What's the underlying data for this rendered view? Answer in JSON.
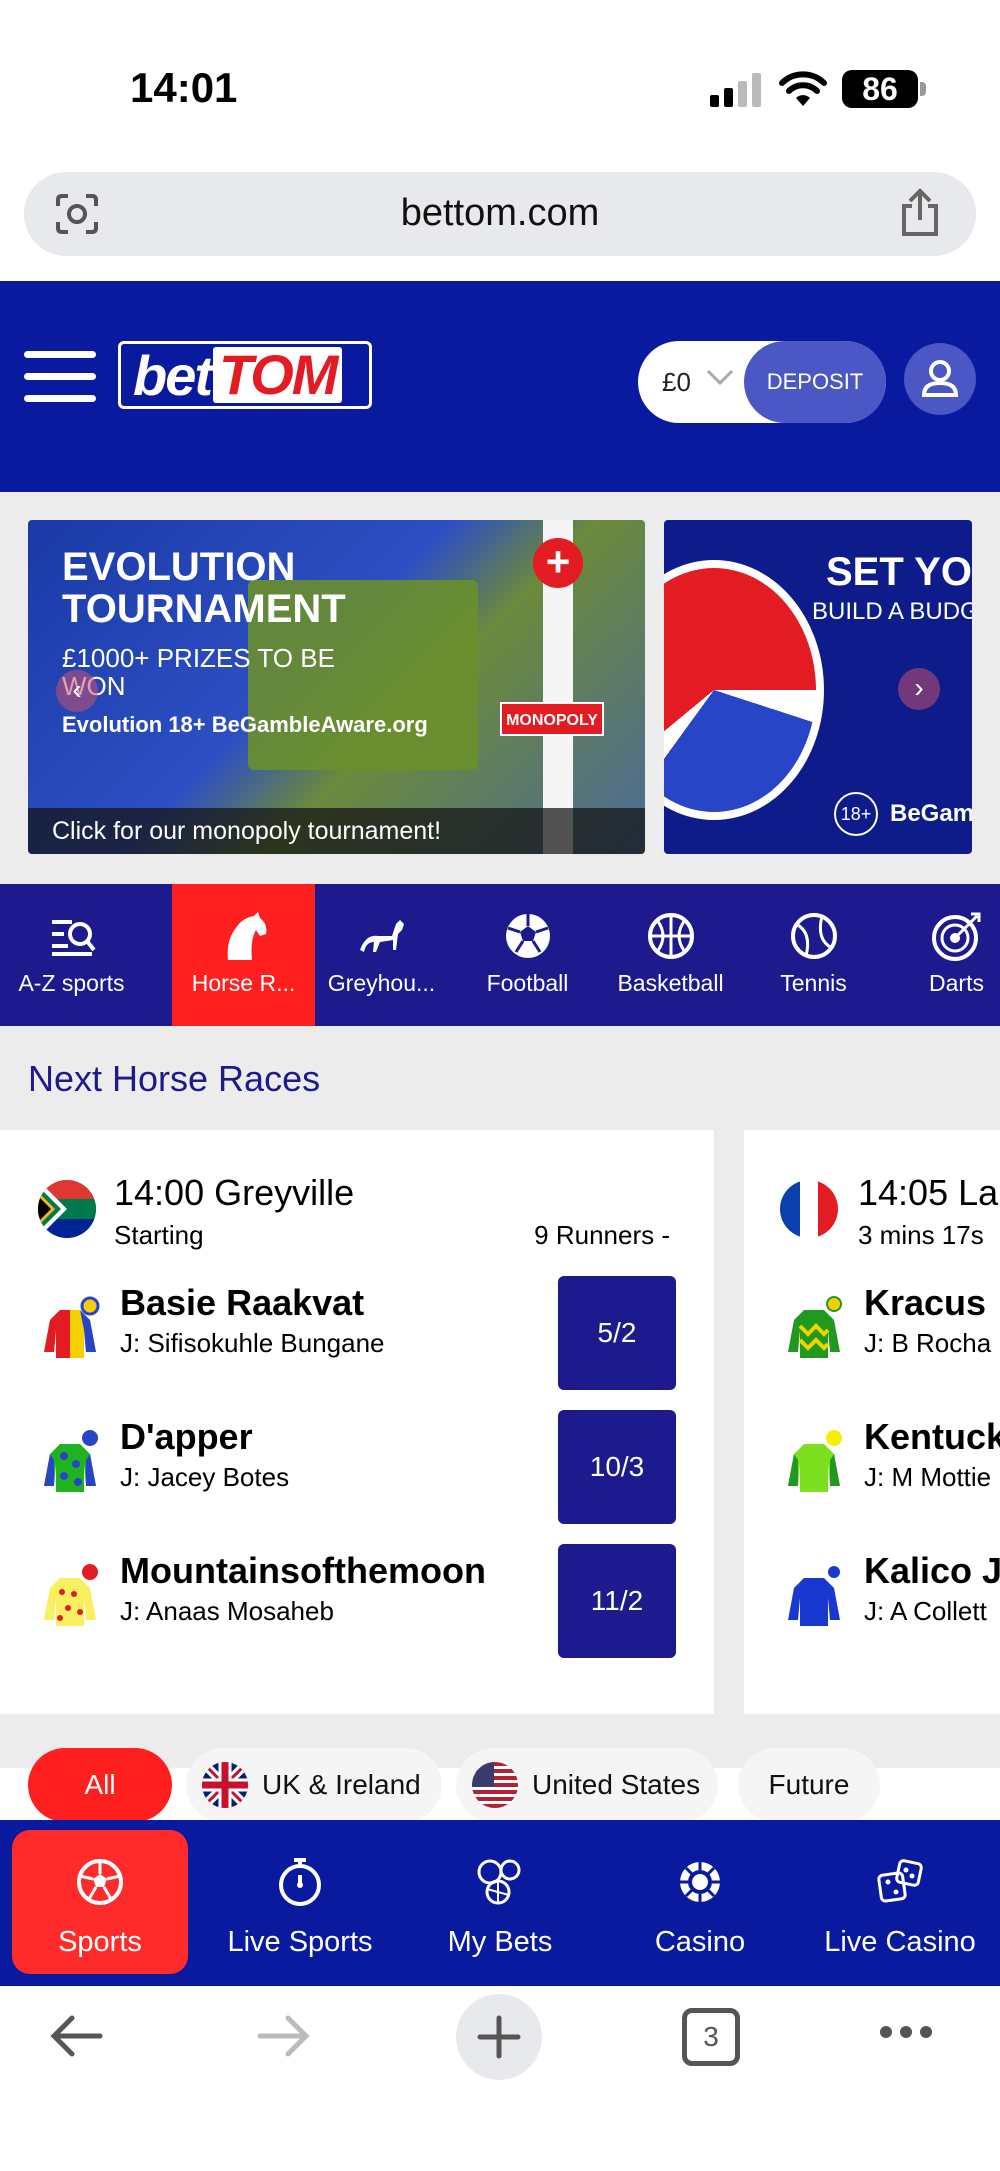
{
  "status_bar": {
    "time": "14:01",
    "battery": "86"
  },
  "browser": {
    "url": "bettom.com",
    "tab_count": "3"
  },
  "header": {
    "logo_bet": "bet",
    "logo_tom": "TOM",
    "balance": "£0",
    "deposit_label": "DEPOSIT"
  },
  "banners": [
    {
      "title": "EVOLUTION TOURNAMENT",
      "prize": "£1000+ PRIZES TO BE WON",
      "brand": "Evolution  18+  BeGambleAware.org",
      "sign": "MONOPOLY",
      "caption": "Click for our monopoly tournament!"
    },
    {
      "title": "SET YOU",
      "subtitle": "BUILD A BUDG",
      "age": "18+",
      "aware": "BeGam"
    }
  ],
  "sports_nav": [
    {
      "label": "A-Z sports",
      "icon": "az-search-icon"
    },
    {
      "label": "Horse R...",
      "icon": "horse-icon",
      "active": true
    },
    {
      "label": "Greyhou...",
      "icon": "greyhound-icon"
    },
    {
      "label": "Football",
      "icon": "football-icon"
    },
    {
      "label": "Basketball",
      "icon": "basketball-icon"
    },
    {
      "label": "Tennis",
      "icon": "tennis-icon"
    },
    {
      "label": "Darts",
      "icon": "darts-icon"
    }
  ],
  "races": {
    "title": "Next Horse Races",
    "cards": [
      {
        "time_venue": "14:00 Greyville",
        "status": "Starting",
        "runners_count": "9 Runners  -",
        "runners": [
          {
            "name": "Basie Raakvat",
            "jockey": "J: Sifisokuhle Bungane",
            "odds": "5/2"
          },
          {
            "name": "D'apper",
            "jockey": "J: Jacey Botes",
            "odds": "10/3"
          },
          {
            "name": "Mountainsofthemoon",
            "jockey": "J: Anaas Mosaheb",
            "odds": "11/2"
          }
        ]
      },
      {
        "time_venue": "14:05 La",
        "status": "3 mins 17s",
        "runners": [
          {
            "name": "Kracus",
            "jockey": "J: B Rocha"
          },
          {
            "name": "Kentuck",
            "jockey": "J: M Mottie"
          },
          {
            "name": "Kalico J",
            "jockey": "J: A Collett"
          }
        ]
      }
    ]
  },
  "filters": [
    "All",
    "UK & Ireland",
    "United States",
    "Future"
  ],
  "bottom_nav": [
    {
      "label": "Sports",
      "icon": "football-icon",
      "active": true
    },
    {
      "label": "Live Sports",
      "icon": "stopwatch-icon"
    },
    {
      "label": "My Bets",
      "icon": "bets-icon"
    },
    {
      "label": "Casino",
      "icon": "casino-chip-icon"
    },
    {
      "label": "Live Casino",
      "icon": "dice-icon"
    }
  ],
  "colors": {
    "brand_blue": "#0a1a9e",
    "nav_blue": "#1d1a8e",
    "accent_red": "#ff1f1f"
  }
}
